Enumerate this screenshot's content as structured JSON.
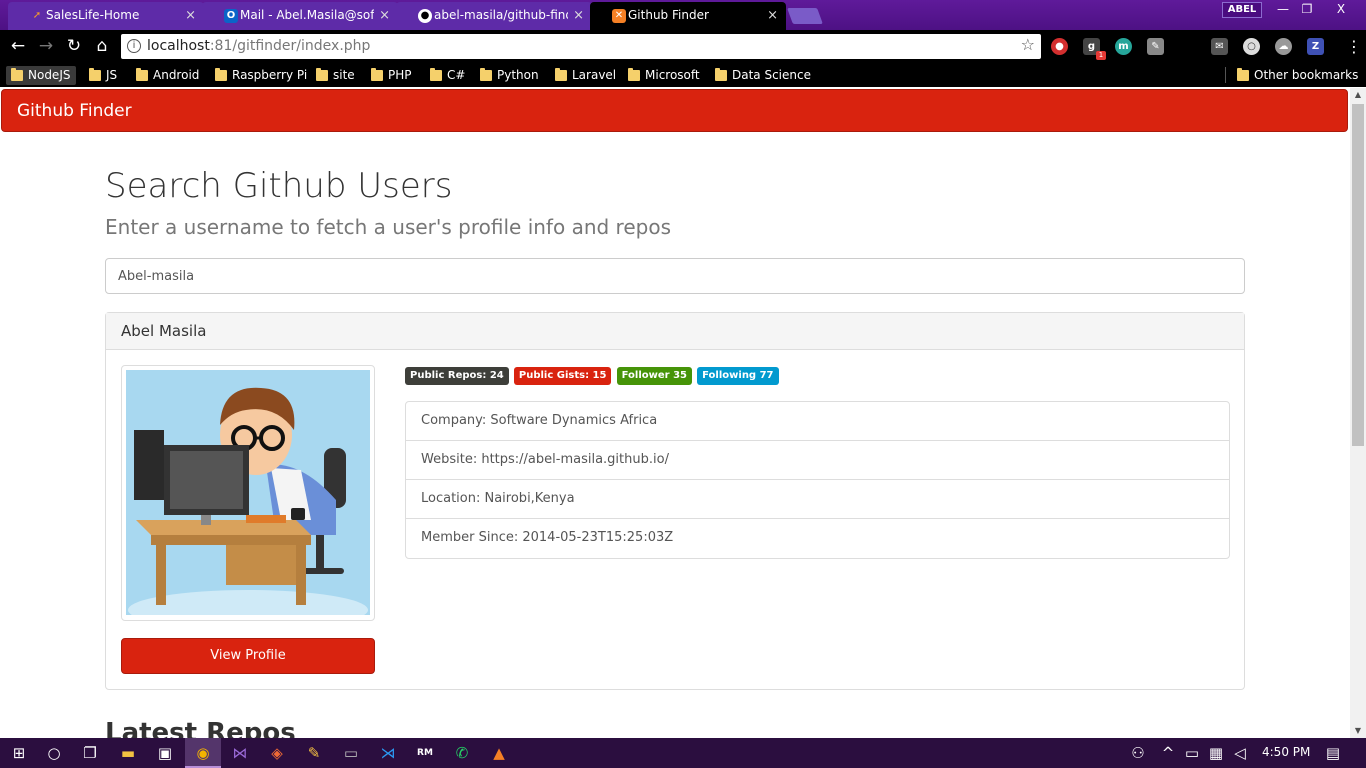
{
  "browser": {
    "tabs": [
      {
        "title": "SalesLife-Home",
        "favicon": "rocket-icon",
        "active": false
      },
      {
        "title": "Mail - Abel.Masila@softw",
        "favicon": "outlook-icon",
        "active": false
      },
      {
        "title": "abel-masila/github-finde",
        "favicon": "github-icon",
        "active": false
      },
      {
        "title": "Github Finder",
        "favicon": "xampp-icon",
        "active": true
      }
    ],
    "tab_close": "×",
    "profile": "ABEL",
    "window_controls": {
      "minimize": "—",
      "restore": "❐",
      "close": "X"
    },
    "url": {
      "host": "localhost",
      "rest": ":81/gitfinder/index.php"
    },
    "bookmarks": [
      "NodeJS",
      "JS",
      "Android",
      "Raspberry Pi",
      "site",
      "PHP",
      "C#",
      "Python",
      "Laravel",
      "Microsoft",
      "Data Science"
    ],
    "other_bookmarks": "Other bookmarks",
    "extension_badge": "1"
  },
  "page": {
    "brand": "Github Finder",
    "title": "Search Github Users",
    "subtitle": "Enter a username to fetch a user's profile info and repos",
    "search": {
      "value": "Abel-masila"
    },
    "profile": {
      "name": "Abel Masila",
      "view_profile_label": "View Profile",
      "badges": [
        {
          "label": "Public Repos: 24",
          "color": "#3e3f3a"
        },
        {
          "label": "Public Gists: 15",
          "color": "#d9230f"
        },
        {
          "label": "Follower 35",
          "color": "#469408"
        },
        {
          "label": "Following 77",
          "color": "#029acf"
        }
      ],
      "details": [
        "Company: Software Dynamics Africa",
        "Website: https://abel-masila.github.io/",
        "Location: Nairobi,Kenya",
        "Member Since: 2014-05-23T15:25:03Z"
      ]
    },
    "latest_repos_title": "Latest Repos"
  },
  "taskbar": {
    "clock": "4:50 PM"
  },
  "colors": {
    "primary": "#d9230f",
    "tab_strip": "#4d1184",
    "taskbar": "#2b0e3f"
  }
}
